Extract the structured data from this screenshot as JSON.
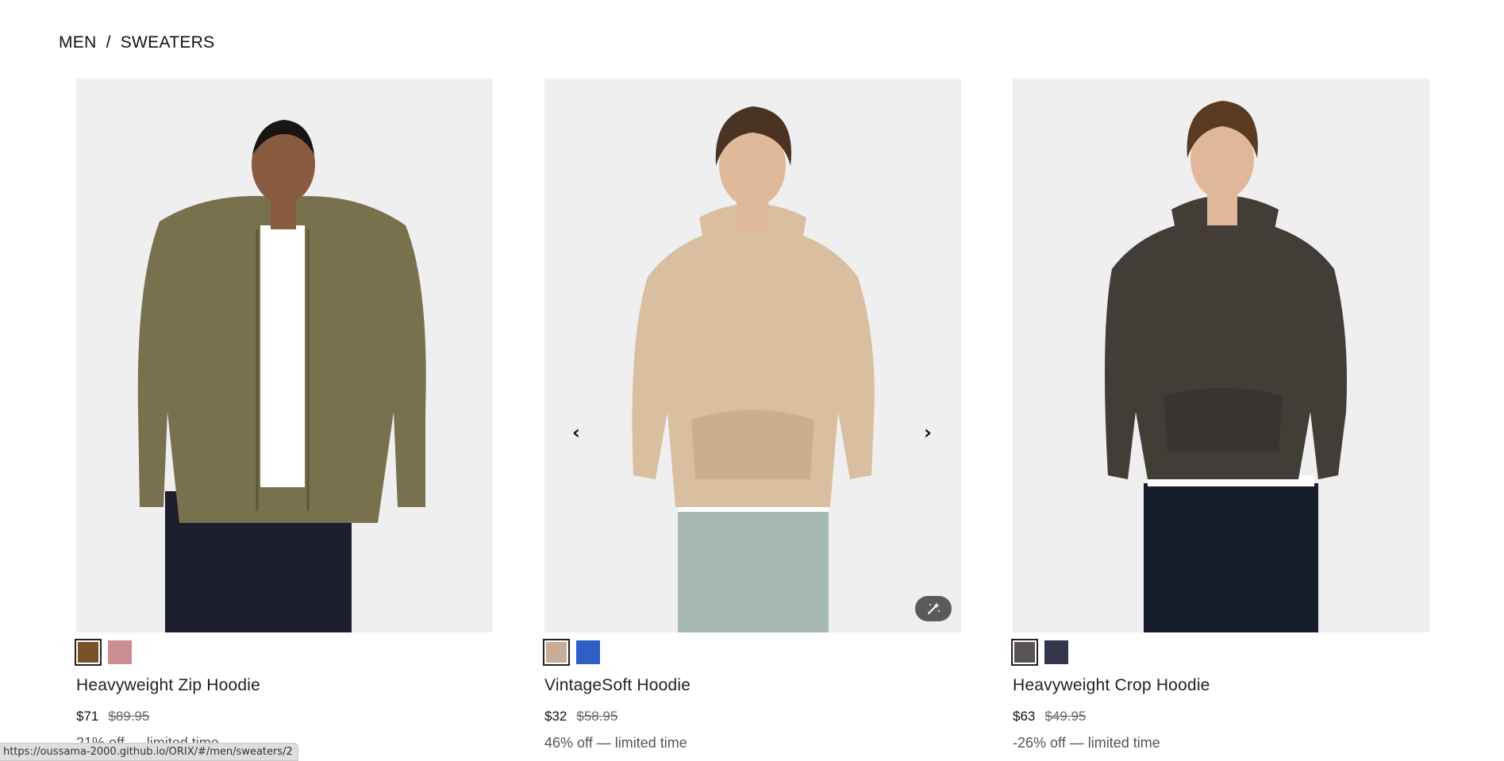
{
  "breadcrumb": {
    "category": "MEN",
    "separator": "/",
    "subcategory": "SWEATERS"
  },
  "products": [
    {
      "name": "Heavyweight Zip Hoodie",
      "price": "$71",
      "original_price": "$89.95",
      "promo": "21% off — limited time",
      "swatches": [
        "#7a5227",
        "#c98f92"
      ],
      "garment_color": "#77714e",
      "pants_color": "#1c1e2e",
      "skin_color": "#8a5a40",
      "hair_color": "#1a1512"
    },
    {
      "name": "VintageSoft Hoodie",
      "price": "$32",
      "original_price": "$58.95",
      "promo": "46% off — limited time",
      "swatches": [
        "#c9ad96",
        "#2f5fc4"
      ],
      "garment_color": "#d9bf9f",
      "pants_color": "#a7b9b3",
      "skin_color": "#e0b89a",
      "hair_color": "#4a3322",
      "prev_icon": "chevron-left-icon",
      "next_icon": "chevron-right-icon",
      "magic_icon": "magic-wand-icon"
    },
    {
      "name": "Heavyweight Crop Hoodie",
      "price": "$63",
      "original_price": "$49.95",
      "promo": "-26% off — limited time",
      "swatches": [
        "#5a5353",
        "#34354a"
      ],
      "garment_color": "#433d38",
      "pants_color": "#181d2c",
      "skin_color": "#e1b79a",
      "hair_color": "#5a3a20"
    }
  ],
  "status_bar": {
    "url": "https://oussama-2000.github.io/ORIX/#/men/sweaters/2"
  }
}
